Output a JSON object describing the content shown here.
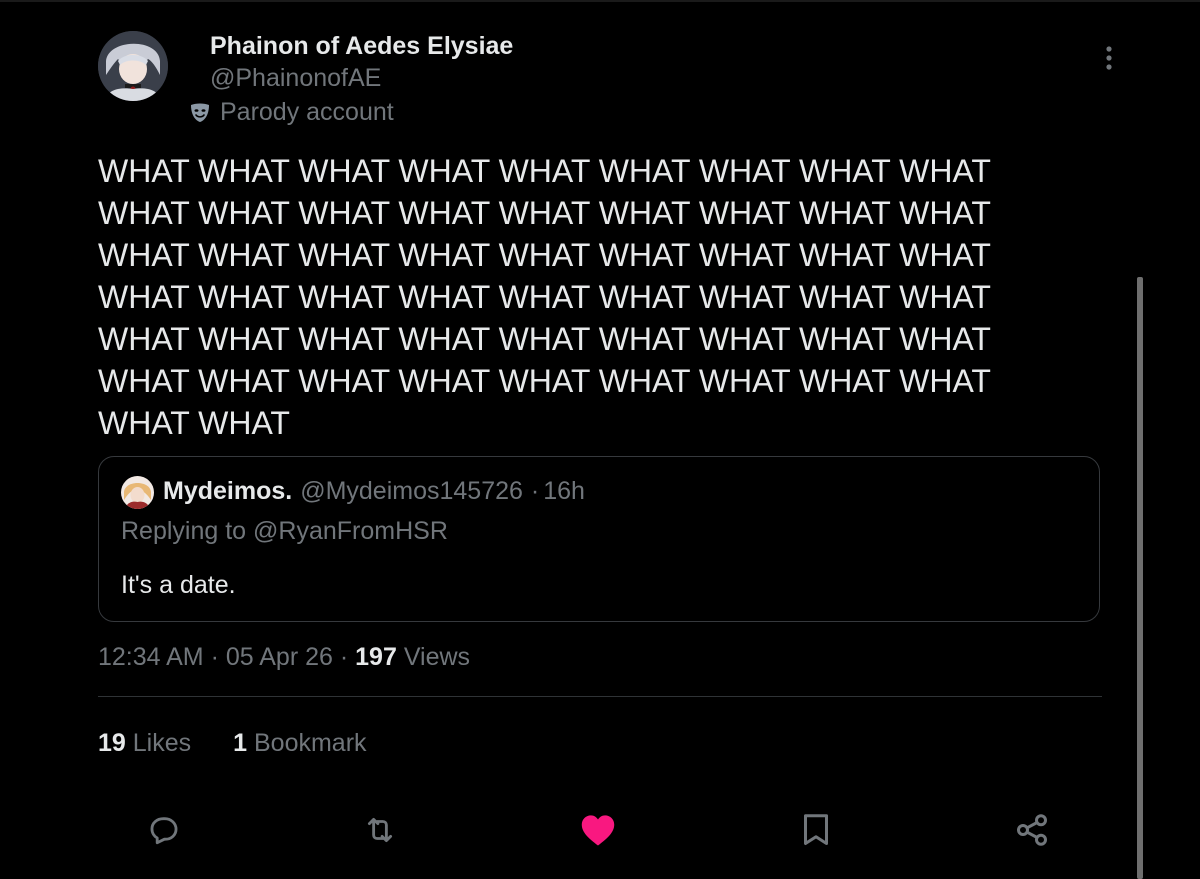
{
  "author": {
    "display_name": "Phainon of Aedes Elysiae",
    "handle": "@PhainonofAE",
    "badge_label": "Parody account",
    "badge_icon": "parody-mask-icon"
  },
  "post": {
    "text": "WHAT WHAT WHAT WHAT WHAT WHAT WHAT WHAT WHAT WHAT WHAT WHAT WHAT WHAT WHAT WHAT WHAT WHAT WHAT WHAT WHAT WHAT WHAT WHAT WHAT WHAT WHAT WHAT WHAT WHAT WHAT WHAT WHAT WHAT WHAT WHAT WHAT WHAT WHAT WHAT WHAT WHAT WHAT WHAT WHAT WHAT WHAT WHAT WHAT WHAT WHAT WHAT WHAT WHAT WHAT WHAT"
  },
  "quote": {
    "display_name": "Mydeimos.",
    "handle": "@Mydeimos145726",
    "separator": "·",
    "age": "16h",
    "replying_prefix": "Replying to",
    "replying_handle": "@RyanFromHSR",
    "text": "It's a date."
  },
  "meta": {
    "time": "12:34 AM",
    "separator": "·",
    "date": "05 Apr 26",
    "views_count": "197",
    "views_label": "Views"
  },
  "stats": {
    "likes_count": "19",
    "likes_label": "Likes",
    "bookmarks_count": "1",
    "bookmarks_label": "Bookmark"
  },
  "actions": {
    "reply_icon": "reply-icon",
    "repost_icon": "repost-icon",
    "like_icon": "heart-filled-icon",
    "bookmark_icon": "bookmark-icon",
    "share_icon": "share-icon"
  },
  "colors": {
    "background": "#000000",
    "text_primary": "#e7e9ea",
    "text_secondary": "#71767b",
    "like_active": "#f91880",
    "border": "#2f3336"
  }
}
